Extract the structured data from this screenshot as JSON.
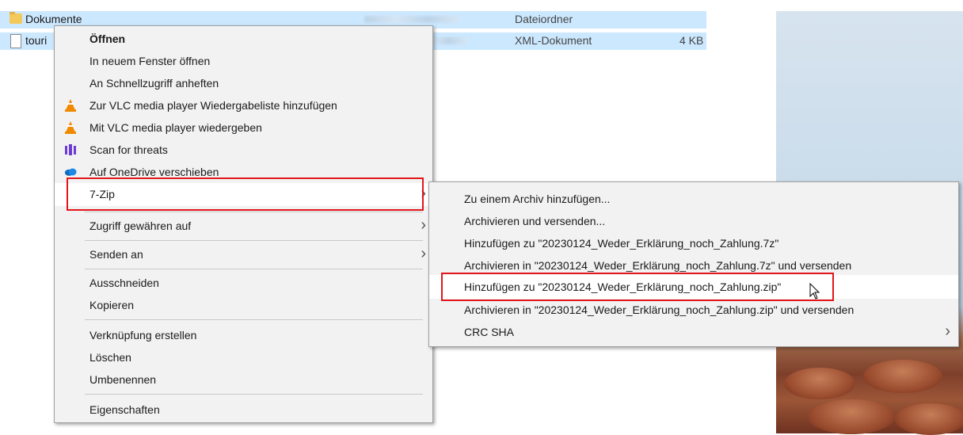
{
  "files": [
    {
      "name": "Dokumente",
      "type": "Dateiordner",
      "size": ""
    },
    {
      "name": "touri",
      "type": "XML-Dokument",
      "size": "4 KB"
    }
  ],
  "context_menu": {
    "items": [
      {
        "label": "Öffnen",
        "bold": true,
        "icon": ""
      },
      {
        "label": "In neuem Fenster öffnen",
        "icon": ""
      },
      {
        "label": "An Schnellzugriff anheften",
        "icon": ""
      },
      {
        "label": "Zur VLC media player Wiedergabeliste hinzufügen",
        "icon": "vlc-cone-icon"
      },
      {
        "label": "Mit VLC media player wiedergeben",
        "icon": "vlc-cone-icon"
      },
      {
        "label": "Scan for threats",
        "icon": "malwarebytes-icon"
      },
      {
        "label": "Auf OneDrive verschieben",
        "icon": "onedrive-cloud-icon"
      },
      {
        "label": "7-Zip",
        "submenu": true,
        "highlighted": true
      },
      {
        "label": "Zugriff gewähren auf",
        "submenu": true
      },
      {
        "label": "Senden an",
        "submenu": true
      },
      {
        "label": "Ausschneiden"
      },
      {
        "label": "Kopieren"
      },
      {
        "label": "Verknüpfung erstellen"
      },
      {
        "label": "Löschen"
      },
      {
        "label": "Umbenennen"
      },
      {
        "label": "Eigenschaften"
      }
    ]
  },
  "submenu_7zip": {
    "items": [
      {
        "label": "Zu einem Archiv hinzufügen..."
      },
      {
        "label": "Archivieren und versenden..."
      },
      {
        "label": "Hinzufügen zu \"20230124_Weder_Erklärung_noch_Zahlung.7z\""
      },
      {
        "label": "Archivieren in \"20230124_Weder_Erklärung_noch_Zahlung.7z\" und versenden"
      },
      {
        "label": "Hinzufügen zu \"20230124_Weder_Erklärung_noch_Zahlung.zip\"",
        "hovered": true
      },
      {
        "label": "Archivieren in \"20230124_Weder_Erklärung_noch_Zahlung.zip\" und versenden"
      },
      {
        "label": "CRC SHA",
        "submenu": true
      }
    ]
  },
  "colors": {
    "highlight_box": "#e2161b",
    "row_selection": "#cce8ff",
    "menu_bg": "#f2f2f2",
    "hover_bg": "#ffffff"
  }
}
